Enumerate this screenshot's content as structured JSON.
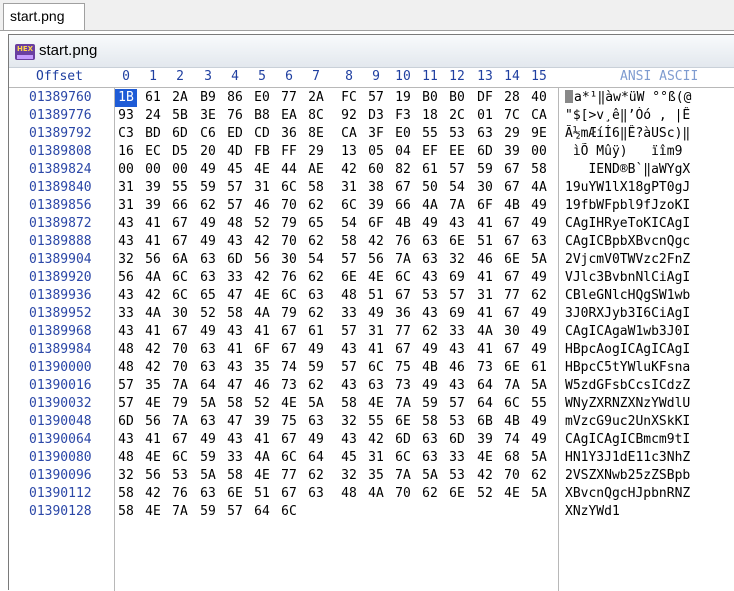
{
  "tab": {
    "label": "start.png"
  },
  "window": {
    "title": "start.png",
    "logo_text": "HEX"
  },
  "header": {
    "offset_label": "Offset",
    "columns": [
      "0",
      "1",
      "2",
      "3",
      "4",
      "5",
      "6",
      "7",
      "8",
      "9",
      "10",
      "11",
      "12",
      "13",
      "14",
      "15"
    ],
    "ansi_label": "ANSI ASCII"
  },
  "selection": {
    "row": 0,
    "col": 0
  },
  "rows": [
    {
      "offset": "01389760",
      "bytes": [
        "1B",
        "61",
        "2A",
        "B9",
        "86",
        "E0",
        "77",
        "2A",
        "FC",
        "57",
        "19",
        "B0",
        "B0",
        "DF",
        "28",
        "40"
      ],
      "ansi": "a*¹‖àw*üW °°ß(@"
    },
    {
      "offset": "01389776",
      "bytes": [
        "93",
        "24",
        "5B",
        "3E",
        "76",
        "B8",
        "EA",
        "8C",
        "92",
        "D3",
        "F3",
        "18",
        "2C",
        "01",
        "7C",
        "CA"
      ],
      "ansi": "\"$[>v¸ê‖’Óó , |Ê"
    },
    {
      "offset": "01389792",
      "bytes": [
        "C3",
        "BD",
        "6D",
        "C6",
        "ED",
        "CD",
        "36",
        "8E",
        "CA",
        "3F",
        "E0",
        "55",
        "53",
        "63",
        "29",
        "9E"
      ],
      "ansi": "Ã½mÆíÍ6‖Ê?àUSc)‖"
    },
    {
      "offset": "01389808",
      "bytes": [
        "16",
        "EC",
        "D5",
        "20",
        "4D",
        "FB",
        "FF",
        "29",
        "13",
        "05",
        "04",
        "EF",
        "EE",
        "6D",
        "39",
        "00"
      ],
      "ansi": " ìÕ Mûÿ)   ïîm9 "
    },
    {
      "offset": "01389824",
      "bytes": [
        "00",
        "00",
        "00",
        "49",
        "45",
        "4E",
        "44",
        "AE",
        "42",
        "60",
        "82",
        "61",
        "57",
        "59",
        "67",
        "58"
      ],
      "ansi": "   IEND®B`‖aWYgX"
    },
    {
      "offset": "01389840",
      "bytes": [
        "31",
        "39",
        "55",
        "59",
        "57",
        "31",
        "6C",
        "58",
        "31",
        "38",
        "67",
        "50",
        "54",
        "30",
        "67",
        "4A"
      ],
      "ansi": "19uYW1lX18gPT0gJ"
    },
    {
      "offset": "01389856",
      "bytes": [
        "31",
        "39",
        "66",
        "62",
        "57",
        "46",
        "70",
        "62",
        "6C",
        "39",
        "66",
        "4A",
        "7A",
        "6F",
        "4B",
        "49"
      ],
      "ansi": "19fbWFpbl9fJzoKI"
    },
    {
      "offset": "01389872",
      "bytes": [
        "43",
        "41",
        "67",
        "49",
        "48",
        "52",
        "79",
        "65",
        "54",
        "6F",
        "4B",
        "49",
        "43",
        "41",
        "67",
        "49"
      ],
      "ansi": "CAgIHRyeToKICAgI"
    },
    {
      "offset": "01389888",
      "bytes": [
        "43",
        "41",
        "67",
        "49",
        "43",
        "42",
        "70",
        "62",
        "58",
        "42",
        "76",
        "63",
        "6E",
        "51",
        "67",
        "63"
      ],
      "ansi": "CAgICBpbXBvcnQgc"
    },
    {
      "offset": "01389904",
      "bytes": [
        "32",
        "56",
        "6A",
        "63",
        "6D",
        "56",
        "30",
        "54",
        "57",
        "56",
        "7A",
        "63",
        "32",
        "46",
        "6E",
        "5A"
      ],
      "ansi": "2VjcmV0TWVzc2FnZ"
    },
    {
      "offset": "01389920",
      "bytes": [
        "56",
        "4A",
        "6C",
        "63",
        "33",
        "42",
        "76",
        "62",
        "6E",
        "4E",
        "6C",
        "43",
        "69",
        "41",
        "67",
        "49"
      ],
      "ansi": "VJlc3BvbnNlCiAgI"
    },
    {
      "offset": "01389936",
      "bytes": [
        "43",
        "42",
        "6C",
        "65",
        "47",
        "4E",
        "6C",
        "63",
        "48",
        "51",
        "67",
        "53",
        "57",
        "31",
        "77",
        "62"
      ],
      "ansi": "CBleGNlcHQgSW1wb"
    },
    {
      "offset": "01389952",
      "bytes": [
        "33",
        "4A",
        "30",
        "52",
        "58",
        "4A",
        "79",
        "62",
        "33",
        "49",
        "36",
        "43",
        "69",
        "41",
        "67",
        "49"
      ],
      "ansi": "3J0RXJyb3I6CiAgI"
    },
    {
      "offset": "01389968",
      "bytes": [
        "43",
        "41",
        "67",
        "49",
        "43",
        "41",
        "67",
        "61",
        "57",
        "31",
        "77",
        "62",
        "33",
        "4A",
        "30",
        "49"
      ],
      "ansi": "CAgICAgaW1wb3J0I"
    },
    {
      "offset": "01389984",
      "bytes": [
        "48",
        "42",
        "70",
        "63",
        "41",
        "6F",
        "67",
        "49",
        "43",
        "41",
        "67",
        "49",
        "43",
        "41",
        "67",
        "49"
      ],
      "ansi": "HBpcAogICAgICAgI"
    },
    {
      "offset": "01390000",
      "bytes": [
        "48",
        "42",
        "70",
        "63",
        "43",
        "35",
        "74",
        "59",
        "57",
        "6C",
        "75",
        "4B",
        "46",
        "73",
        "6E",
        "61"
      ],
      "ansi": "HBpcC5tYWluKFsna"
    },
    {
      "offset": "01390016",
      "bytes": [
        "57",
        "35",
        "7A",
        "64",
        "47",
        "46",
        "73",
        "62",
        "43",
        "63",
        "73",
        "49",
        "43",
        "64",
        "7A",
        "5A"
      ],
      "ansi": "W5zdGFsbCcsICdzZ"
    },
    {
      "offset": "01390032",
      "bytes": [
        "57",
        "4E",
        "79",
        "5A",
        "58",
        "52",
        "4E",
        "5A",
        "58",
        "4E",
        "7A",
        "59",
        "57",
        "64",
        "6C",
        "55"
      ],
      "ansi": "WNyZXRNZXNzYWdlU"
    },
    {
      "offset": "01390048",
      "bytes": [
        "6D",
        "56",
        "7A",
        "63",
        "47",
        "39",
        "75",
        "63",
        "32",
        "55",
        "6E",
        "58",
        "53",
        "6B",
        "4B",
        "49"
      ],
      "ansi": "mVzcG9uc2UnXSkKI"
    },
    {
      "offset": "01390064",
      "bytes": [
        "43",
        "41",
        "67",
        "49",
        "43",
        "41",
        "67",
        "49",
        "43",
        "42",
        "6D",
        "63",
        "6D",
        "39",
        "74",
        "49"
      ],
      "ansi": "CAgICAgICBmcm9tI"
    },
    {
      "offset": "01390080",
      "bytes": [
        "48",
        "4E",
        "6C",
        "59",
        "33",
        "4A",
        "6C",
        "64",
        "45",
        "31",
        "6C",
        "63",
        "33",
        "4E",
        "68",
        "5A"
      ],
      "ansi": "HN1Y3J1dE11c3NhZ"
    },
    {
      "offset": "01390096",
      "bytes": [
        "32",
        "56",
        "53",
        "5A",
        "58",
        "4E",
        "77",
        "62",
        "32",
        "35",
        "7A",
        "5A",
        "53",
        "42",
        "70",
        "62"
      ],
      "ansi": "2VSZXNwb25zZSBpb"
    },
    {
      "offset": "01390112",
      "bytes": [
        "58",
        "42",
        "76",
        "63",
        "6E",
        "51",
        "67",
        "63",
        "48",
        "4A",
        "70",
        "62",
        "6E",
        "52",
        "4E",
        "5A"
      ],
      "ansi": "XBvcnQgcHJpbnRNZ"
    },
    {
      "offset": "01390128",
      "bytes": [
        "58",
        "4E",
        "7A",
        "59",
        "57",
        "64",
        "6C"
      ],
      "ansi": "XNzYWd1"
    }
  ],
  "colors": {
    "offset_text": "#2b47a7",
    "header_text": "#1f3fa0",
    "selection": "#1e5bd6"
  }
}
